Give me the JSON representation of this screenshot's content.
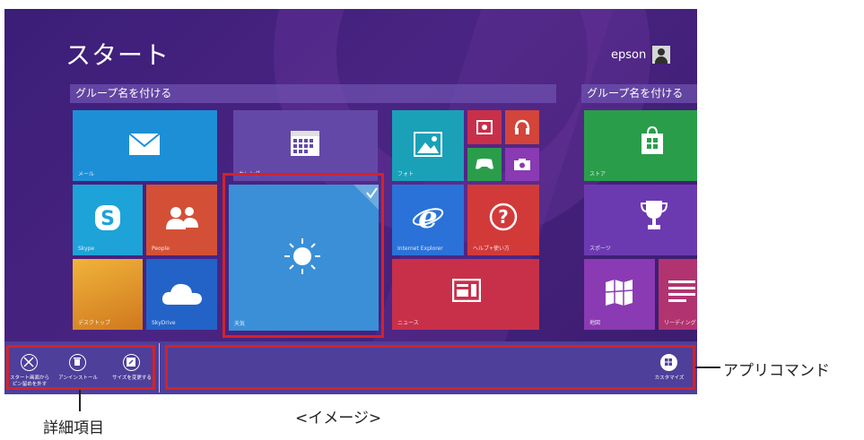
{
  "start": {
    "title": "スタート",
    "user_name": "epson"
  },
  "groups": [
    {
      "label": "グループ名を付ける"
    },
    {
      "label": "グループ名を付ける"
    }
  ],
  "tiles": {
    "mail": "メール",
    "calendar": "カレンダー",
    "photos": "フォト",
    "skype": "Skype",
    "people": "People",
    "weather": "天気",
    "ie": "Internet Explorer",
    "help": "ヘルプ+使い方",
    "desktop": "デスクトップ",
    "skydrive": "SkyDrive",
    "news": "ニュース",
    "store": "ストア",
    "sports": "スポーツ",
    "maps": "地図",
    "reading": "リーディング"
  },
  "appbar": {
    "unpin_label_1": "スタート画面から",
    "unpin_label_2": "ピン留めを外す",
    "uninstall_label": "アンインストール",
    "resize_label": "サイズを変更する",
    "customize_label": "カスタマイズ"
  },
  "annotations": {
    "app_commands": "アプリコマンド",
    "details": "詳細項目",
    "image_caption": "<イメージ>"
  },
  "colors": {
    "background": "#3b1e78",
    "mail": "#1d8fd6",
    "calendar": "#6448a8",
    "photos": "#1aa1b8",
    "skype": "#1da3d8",
    "people": "#d35036",
    "weather": "#3b8fd6",
    "ie": "#2a72d8",
    "help": "#d23a3a",
    "desktop": "#e0982a",
    "skydrive": "#2363c8",
    "news": "#c8304a",
    "store": "#2a9d4a",
    "sports": "#6c3ab0",
    "maps": "#8a3ab2",
    "reading": "#b13470",
    "appbar": "#4e3f9b",
    "highlight": "#d2232a"
  }
}
